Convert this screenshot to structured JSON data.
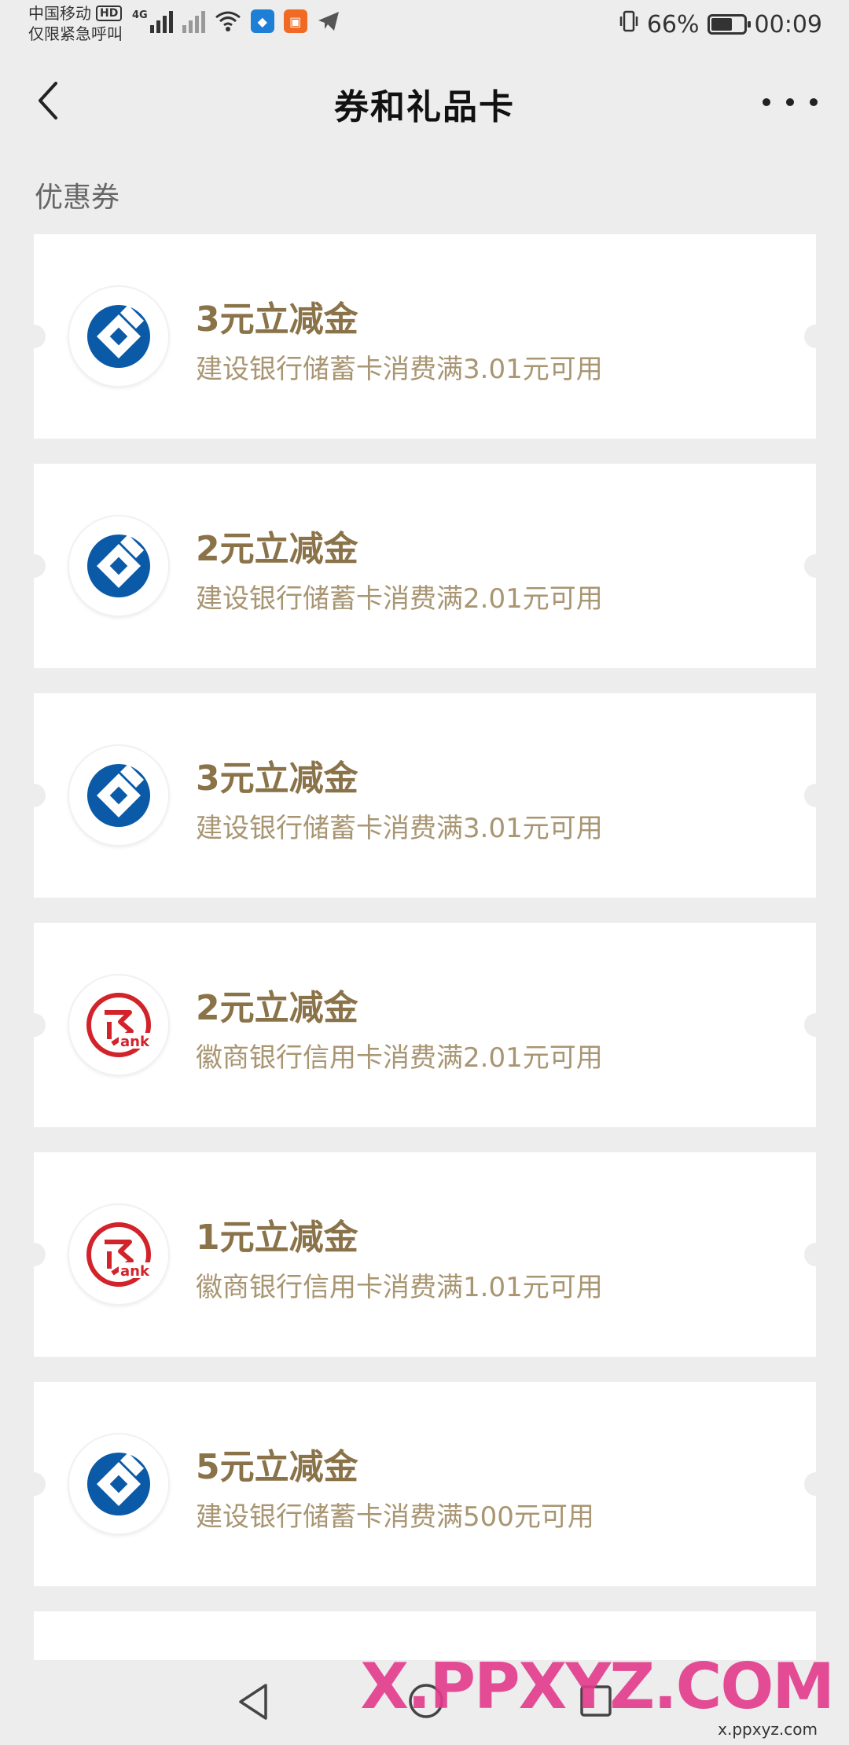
{
  "status_bar": {
    "carrier": "中国移动",
    "hd": "HD",
    "emergency": "仅限紧急呼叫",
    "network": "4G",
    "battery_percent": "66%",
    "battery_level": 0.66,
    "time": "00:09"
  },
  "header": {
    "title": "券和礼品卡"
  },
  "section": {
    "title": "优惠券"
  },
  "coupons": [
    {
      "title": "3元立减金",
      "desc": "建设银行储蓄卡消费满3.01元可用",
      "bank": "ccb-logo-icon"
    },
    {
      "title": "2元立减金",
      "desc": "建设银行储蓄卡消费满2.01元可用",
      "bank": "ccb-logo-icon"
    },
    {
      "title": "3元立减金",
      "desc": "建设银行储蓄卡消费满3.01元可用",
      "bank": "ccb-logo-icon"
    },
    {
      "title": "2元立减金",
      "desc": "徽商银行信用卡消费满2.01元可用",
      "bank": "hsb-logo-icon"
    },
    {
      "title": "1元立减金",
      "desc": "徽商银行信用卡消费满1.01元可用",
      "bank": "hsb-logo-icon"
    },
    {
      "title": "5元立减金",
      "desc": "建设银行储蓄卡消费满500元可用",
      "bank": "ccb-logo-icon"
    }
  ],
  "watermark": {
    "text": "X.PPXYZ.COM",
    "small": "x.ppxyz.com"
  },
  "colors": {
    "coupon_title": "#8a7249",
    "coupon_desc": "#a89572",
    "ccb_blue": "#0b5aa8",
    "hsb_red": "#d2232a",
    "background": "#ededed"
  }
}
